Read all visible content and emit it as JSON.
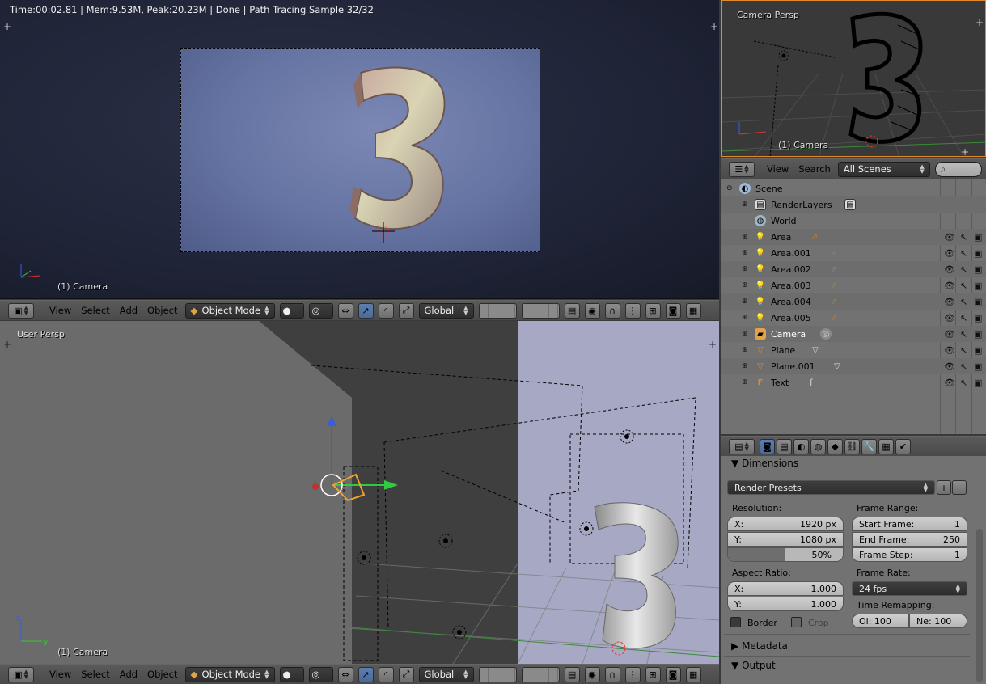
{
  "top_viewport": {
    "status": "Time:00:02.81 | Mem:9.53M, Peak:20.23M | Done | Path Tracing Sample 32/32",
    "camera_label": "(1) Camera",
    "axis_x": "x",
    "axis_y": "y",
    "axis_z": "z"
  },
  "header": {
    "view": "View",
    "select": "Select",
    "add": "Add",
    "object": "Object",
    "mode": "Object Mode",
    "orientation": "Global"
  },
  "bottom_viewport": {
    "title": "User Persp",
    "camera_label": "(1) Camera",
    "axis_y": "y",
    "axis_z": "z"
  },
  "camera_viewport": {
    "title": "Camera Persp",
    "camera_label": "(1) Camera"
  },
  "outliner": {
    "view": "View",
    "search": "Search",
    "scenes": "All Scenes",
    "items": [
      {
        "label": "Scene"
      },
      {
        "label": "RenderLayers"
      },
      {
        "label": "World"
      },
      {
        "label": "Area"
      },
      {
        "label": "Area.001"
      },
      {
        "label": "Area.002"
      },
      {
        "label": "Area.003"
      },
      {
        "label": "Area.004"
      },
      {
        "label": "Area.005"
      },
      {
        "label": "Camera"
      },
      {
        "label": "Plane"
      },
      {
        "label": "Plane.001"
      },
      {
        "label": "Text"
      }
    ]
  },
  "properties": {
    "dimensions": "Dimensions",
    "render_presets": "Render Presets",
    "resolution": "Resolution:",
    "res_x_label": "X:",
    "res_x": "1920 px",
    "res_y_label": "Y:",
    "res_y": "1080 px",
    "res_pct": "50%",
    "res_pct_value": 0.5,
    "frame_range": "Frame Range:",
    "start_frame_label": "Start Frame:",
    "start_frame": "1",
    "end_frame_label": "End Frame:",
    "end_frame": "250",
    "frame_step_label": "Frame Step:",
    "frame_step": "1",
    "aspect_ratio": "Aspect Ratio:",
    "asp_x_label": "X:",
    "asp_x": "1.000",
    "asp_y_label": "Y:",
    "asp_y": "1.000",
    "frame_rate": "Frame Rate:",
    "fps": "24 fps",
    "time_remapping": "Time Remapping:",
    "old": "Ol: 100",
    "new": "Ne: 100",
    "border": "Border",
    "crop": "Crop",
    "metadata": "Metadata",
    "output": "Output"
  },
  "colors": {
    "accent_blue": "#5c7fb0",
    "selection_orange": "#e08a2a"
  }
}
